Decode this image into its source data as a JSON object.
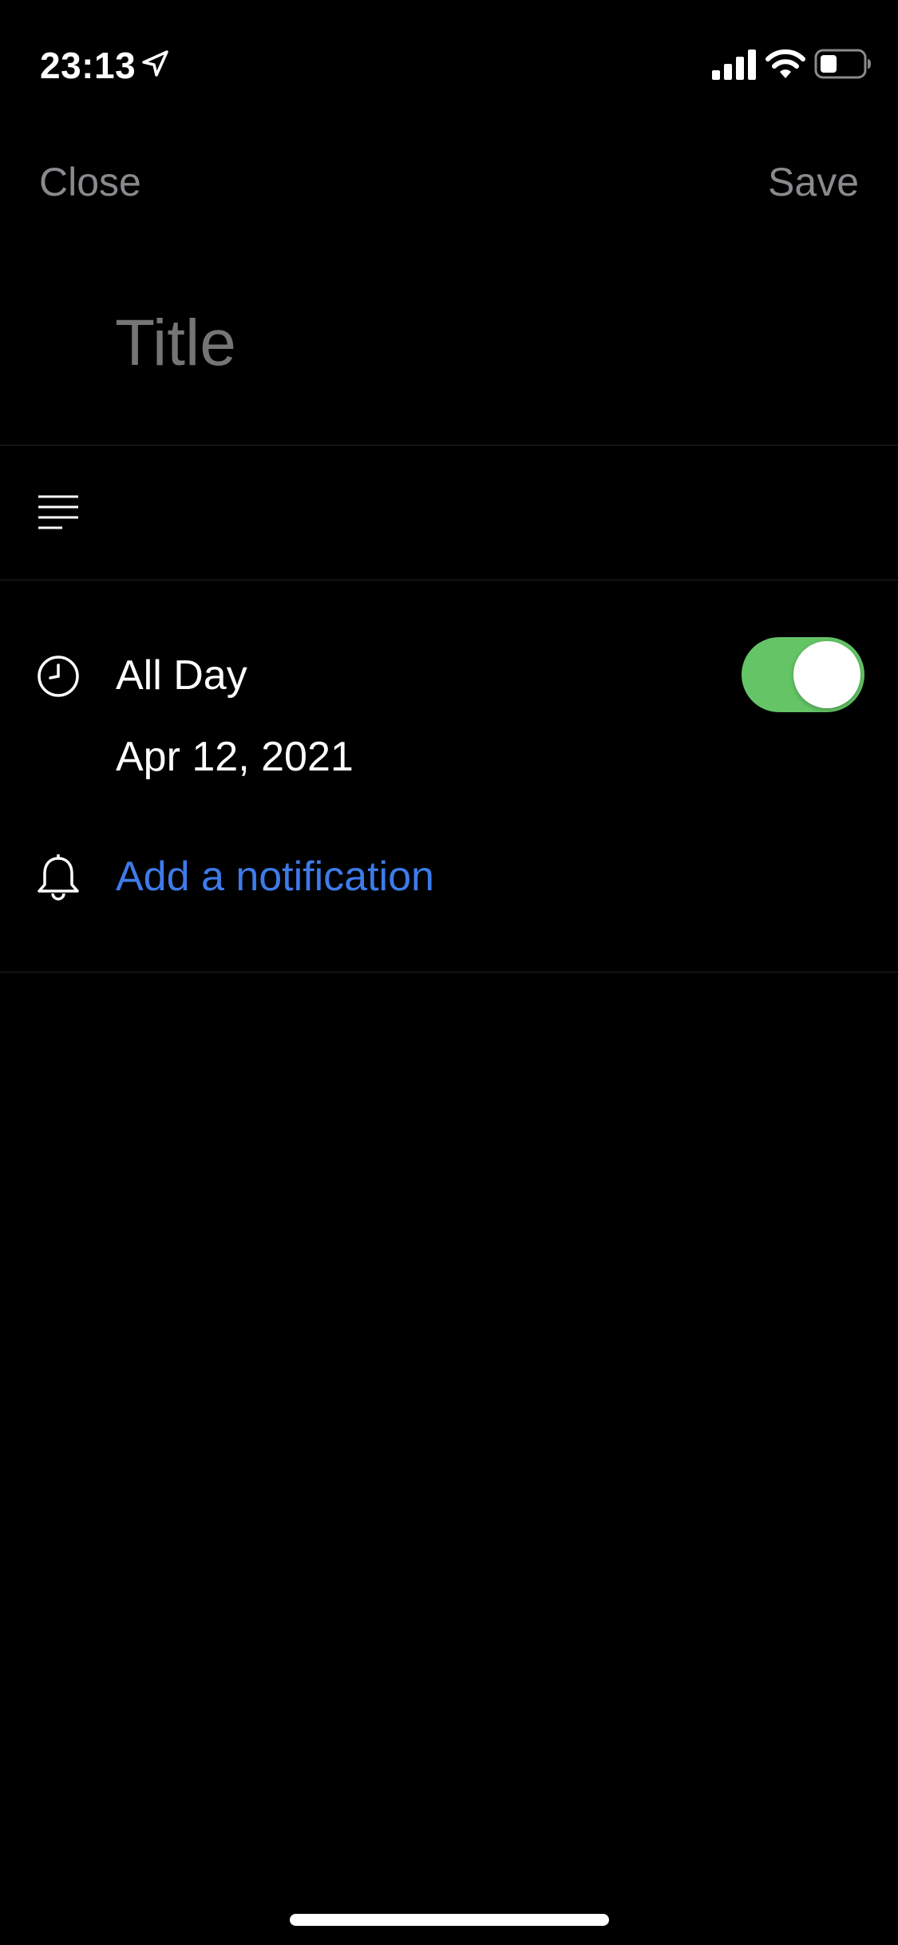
{
  "status_bar": {
    "time": "23:13",
    "icons": [
      "location-arrow-icon",
      "cellular-signal-icon",
      "wifi-icon",
      "battery-icon"
    ]
  },
  "nav": {
    "close_label": "Close",
    "save_label": "Save"
  },
  "title_field": {
    "placeholder": "Title",
    "value": ""
  },
  "notes": {
    "icon": "notes-lines-icon"
  },
  "all_day": {
    "icon": "clock-icon",
    "label": "All Day",
    "enabled": true,
    "date": "Apr 12, 2021"
  },
  "notification": {
    "icon": "bell-icon",
    "label": "Add a notification"
  },
  "colors": {
    "background": "#000000",
    "nav_text": "#8a8a8e",
    "placeholder": "#404042",
    "toggle_on": "#64c466",
    "link": "#3e7bea",
    "divider": "#222224"
  }
}
